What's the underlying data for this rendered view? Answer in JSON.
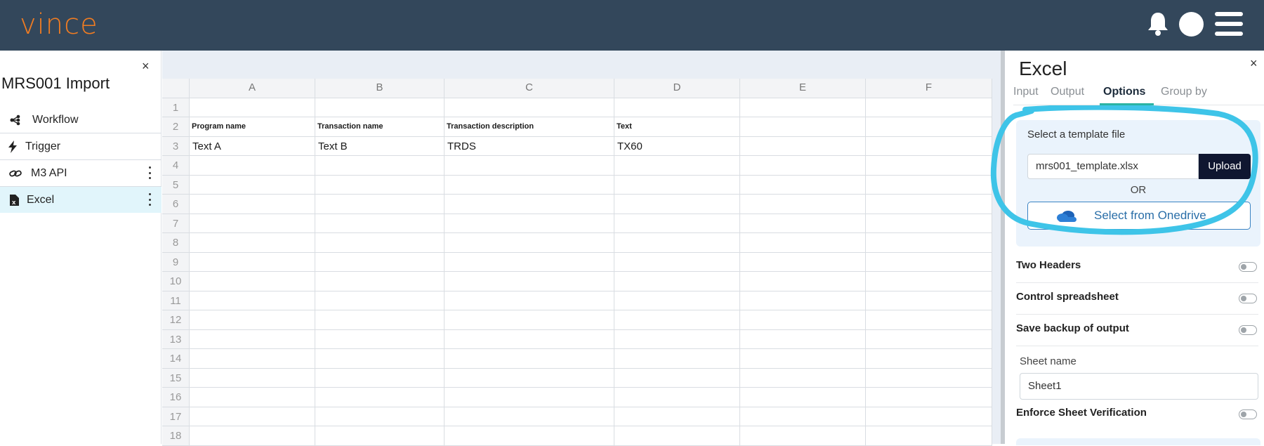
{
  "app": {
    "logo": "vince"
  },
  "header_icons": [
    "bell-icon",
    "user-avatar",
    "hamburger-menu-icon"
  ],
  "left_panel": {
    "title": "MRS001 Import",
    "close": "×",
    "items": [
      {
        "label": "Workflow",
        "icon": "workflow-icon"
      },
      {
        "label": "Trigger",
        "icon": "lightning-icon"
      },
      {
        "label": "M3 API",
        "icon": "link-icon"
      },
      {
        "label": "Excel",
        "icon": "excel-file-icon"
      }
    ]
  },
  "sheet": {
    "columns": [
      "A",
      "B",
      "C",
      "D",
      "E",
      "F"
    ],
    "rows": [
      "1",
      "2",
      "3",
      "4",
      "5",
      "6",
      "7",
      "8",
      "9",
      "10",
      "11",
      "12",
      "13",
      "14",
      "15",
      "16",
      "17",
      "18"
    ],
    "row2": [
      "Program name",
      "Transaction name",
      "Transaction description",
      "Text"
    ],
    "row3": [
      "Text A",
      "Text B",
      "TRDS",
      "TX60"
    ]
  },
  "right_panel": {
    "title": "Excel",
    "close": "×",
    "tabs": [
      "Input",
      "Output",
      "Options",
      "Group by"
    ],
    "active_tab": "Options",
    "template": {
      "label": "Select a template file",
      "value": "mrs001_template.xlsx",
      "upload_label": "Upload",
      "or_label": "OR",
      "onedrive_label": "Select from Onedrive"
    },
    "options": [
      {
        "label": "Two Headers",
        "enabled": false
      },
      {
        "label": "Control spreadsheet",
        "enabled": false
      },
      {
        "label": "Save backup of output",
        "enabled": false
      }
    ],
    "sheet_name_label": "Sheet name",
    "sheet_name_value": "Sheet1",
    "enforce_label": "Enforce Sheet Verification",
    "enforce_enabled": false
  },
  "colors": {
    "header_bg": "#33475b",
    "logo": "#f07c22",
    "highlight": "#3ec4e8",
    "upload_bg": "#0f1630",
    "active_tab_underline": "#2bb3a3"
  }
}
